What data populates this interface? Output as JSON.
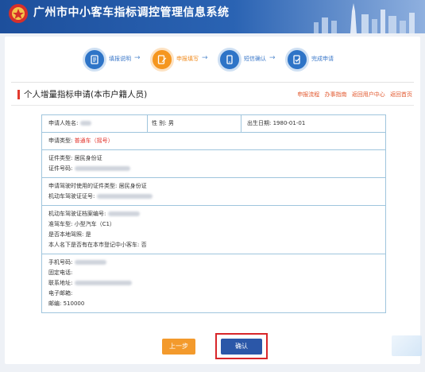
{
  "header": {
    "title": "广州市中小客车指标调控管理信息系统"
  },
  "steps": [
    {
      "label": "填报说明",
      "state": "done",
      "icon": "document-list-icon"
    },
    {
      "label": "申报填写",
      "state": "current",
      "icon": "form-edit-icon"
    },
    {
      "label": "短信确认",
      "state": "todo",
      "icon": "phone-sms-icon"
    },
    {
      "label": "完成申请",
      "state": "todo",
      "icon": "check-document-icon"
    }
  ],
  "section": {
    "title": "个人增量指标申请(本市户籍人员)"
  },
  "top_links": [
    "申报流程",
    "办事指南",
    "返回用户中心",
    "返回首页"
  ],
  "form": {
    "applicant_name_label": "申请人姓名:",
    "gender_label": "性 别:",
    "gender_value": "男",
    "birth_label": "出生日期:",
    "birth_value": "1980-01-01",
    "apply_type_label": "申请类型:",
    "apply_type_value": "普通车（摇号）",
    "id_type_label": "证件类型:",
    "id_type_value": "居民身份证",
    "id_number_label": "证件号码:",
    "license_id_type_label": "申请驾驶时使用的证件类型:",
    "license_id_type_value": "居民身份证",
    "license_number_label": "机动车驾驶证证号:",
    "license_file_label": "机动车驾驶证档案编号:",
    "vehicle_class_label": "准驾车型:",
    "vehicle_class_value": "小型汽车（C1）",
    "local_license_label": "是否本地驾照:",
    "local_license_value": "是",
    "has_car_label": "本人名下是否有在本市登记中小客车:",
    "has_car_value": "否",
    "mobile_label": "手机号码:",
    "phone_label": "固定电话:",
    "address_label": "联系地址:",
    "email_label": "电子邮箱:",
    "postcode_label": "邮编:",
    "postcode_value": "510000"
  },
  "buttons": {
    "prev": "上一步",
    "confirm": "确认"
  },
  "colors": {
    "header_blue": "#2a63b3",
    "accent_orange": "#f39a2c",
    "confirm_blue": "#2b57a8",
    "highlight_red": "#d8262a"
  }
}
